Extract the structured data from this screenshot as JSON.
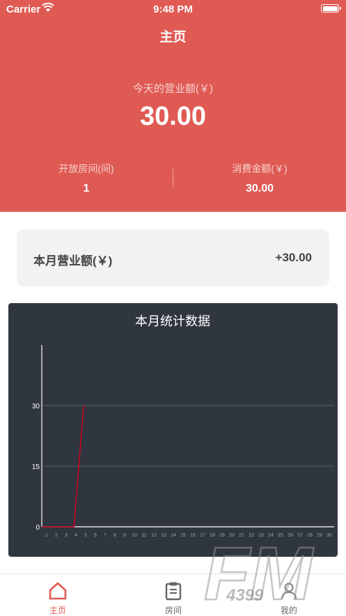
{
  "status_bar": {
    "carrier": "Carrier",
    "time": "9:48 PM"
  },
  "page": {
    "title": "主页"
  },
  "today": {
    "label": "今天的营业额(￥)",
    "value": "30.00"
  },
  "stats": [
    {
      "label": "开放房间(间)",
      "value": "1"
    },
    {
      "label": "消费金额(￥)",
      "value": "30.00"
    }
  ],
  "month": {
    "label": "本月营业额(￥)",
    "value": "+30.00"
  },
  "chart_data": {
    "type": "line",
    "title": "本月统计数据",
    "x": [
      1,
      2,
      3,
      4,
      5,
      6,
      7,
      8,
      9,
      10,
      11,
      12,
      13,
      14,
      15,
      16,
      17,
      18,
      19,
      20,
      21,
      22,
      23,
      24,
      25,
      26,
      27,
      28,
      29,
      30
    ],
    "x_tick_labels": [
      "1",
      "2",
      "3",
      "4",
      "5",
      "6",
      "7",
      "8",
      "9",
      "10",
      "11",
      "12",
      "13",
      "14",
      "15",
      "16",
      "17",
      "18",
      "19",
      "20",
      "21",
      "22",
      "23",
      "24",
      "25",
      "26",
      "27",
      "28",
      "29",
      "30"
    ],
    "series": [
      {
        "x": [
          0.5,
          3.8,
          4.8
        ],
        "values": [
          0,
          0,
          30
        ]
      }
    ],
    "y_ticks": [
      0,
      15,
      30
    ],
    "ylim": [
      0,
      45
    ],
    "grid": true,
    "colors": {
      "line": "#d0021b",
      "axis": "#ffffff",
      "grid": "#5a6069",
      "background": "#303640",
      "text": "#ffffff"
    }
  },
  "tabs": [
    {
      "label": "主页",
      "icon": "home-icon",
      "active": true
    },
    {
      "label": "房间",
      "icon": "clipboard-icon",
      "active": false
    },
    {
      "label": "我的",
      "icon": "person-icon",
      "active": false
    }
  ],
  "watermark": {
    "text": "FM",
    "sub": "4399"
  },
  "colors": {
    "accent": "#e05a54",
    "chart_bg": "#303640"
  }
}
